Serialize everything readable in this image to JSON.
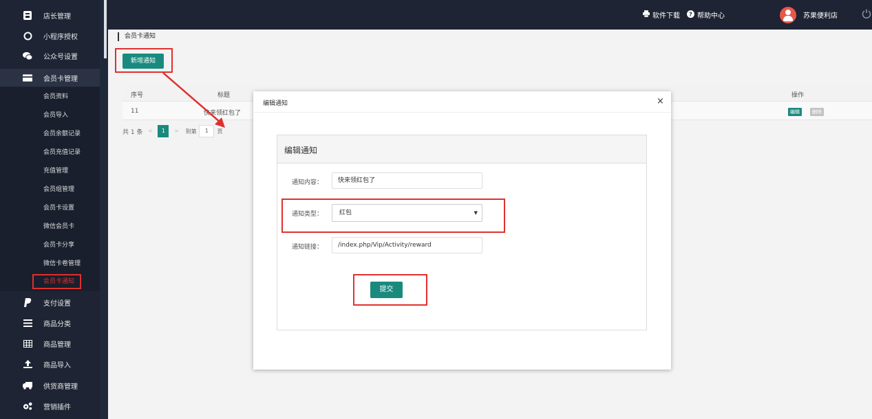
{
  "sidebar": {
    "items": [
      {
        "label": "店长管理",
        "icon": "store-manager-icon"
      },
      {
        "label": "小程序授权",
        "icon": "circle-icon"
      },
      {
        "label": "公众号设置",
        "icon": "wechat-icon"
      },
      {
        "label": "会员卡管理",
        "icon": "card-icon"
      },
      {
        "label": "支付设置",
        "icon": "paypal-icon"
      },
      {
        "label": "商品分类",
        "icon": "list-icon"
      },
      {
        "label": "商品管理",
        "icon": "grid-icon"
      },
      {
        "label": "商品导入",
        "icon": "upload-icon"
      },
      {
        "label": "供货商管理",
        "icon": "truck-icon"
      },
      {
        "label": "营销插件",
        "icon": "gears-icon"
      }
    ],
    "sub_items": [
      "会员资料",
      "会员导入",
      "会员余额记录",
      "会员充值记录",
      "充值管理",
      "会员组管理",
      "会员卡设置",
      "微信会员卡",
      "会员卡分享",
      "微信卡卷管理",
      "会员卡通知"
    ]
  },
  "topbar": {
    "download": "软件下载",
    "help": "帮助中心",
    "user": "苏果便利店"
  },
  "page": {
    "breadcrumb": "会员卡通知",
    "add_button": "新增通知"
  },
  "table": {
    "headers": [
      "序号",
      "标题",
      "操作"
    ],
    "row": {
      "id": "11",
      "title": "快来领红包了"
    },
    "edit_label": "编辑",
    "delete_label": "删除"
  },
  "pager": {
    "total": "共 1 条",
    "prev": "<",
    "current": "1",
    "next": ">",
    "goto": "到第",
    "goto_value": "1",
    "page_unit": "页"
  },
  "modal": {
    "title": "编辑通知",
    "close": "×",
    "panel_title": "编辑通知",
    "content_label": "通知内容：",
    "content_value": "快来领红包了",
    "type_label": "通知类型：",
    "type_value": "红包",
    "link_label": "通知链接：",
    "link_value": "/index.php/Vip/Activity/reward",
    "submit": "提交"
  },
  "colors": {
    "accent": "#1a8a7e",
    "annotation": "#e0302d",
    "sidebar_bg": "#1e2433"
  }
}
